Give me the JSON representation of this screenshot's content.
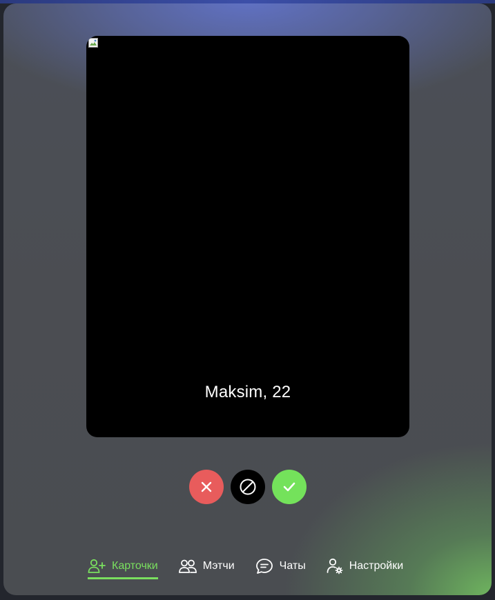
{
  "card": {
    "caption": "Maksim, 22"
  },
  "actions": {
    "dislike_icon": "close-icon",
    "block_icon": "block-icon",
    "like_icon": "check-icon",
    "colors": {
      "dislike": "#e85c5c",
      "block": "#000000",
      "like": "#74e25b"
    }
  },
  "nav": {
    "active_color": "#7ae05f",
    "items": [
      {
        "label": "Карточки",
        "icon": "add-user-icon",
        "active": true
      },
      {
        "label": "Мэтчи",
        "icon": "users-icon",
        "active": false
      },
      {
        "label": "Чаты",
        "icon": "chat-icon",
        "active": false
      },
      {
        "label": "Настройки",
        "icon": "user-settings-icon",
        "active": false
      }
    ]
  }
}
